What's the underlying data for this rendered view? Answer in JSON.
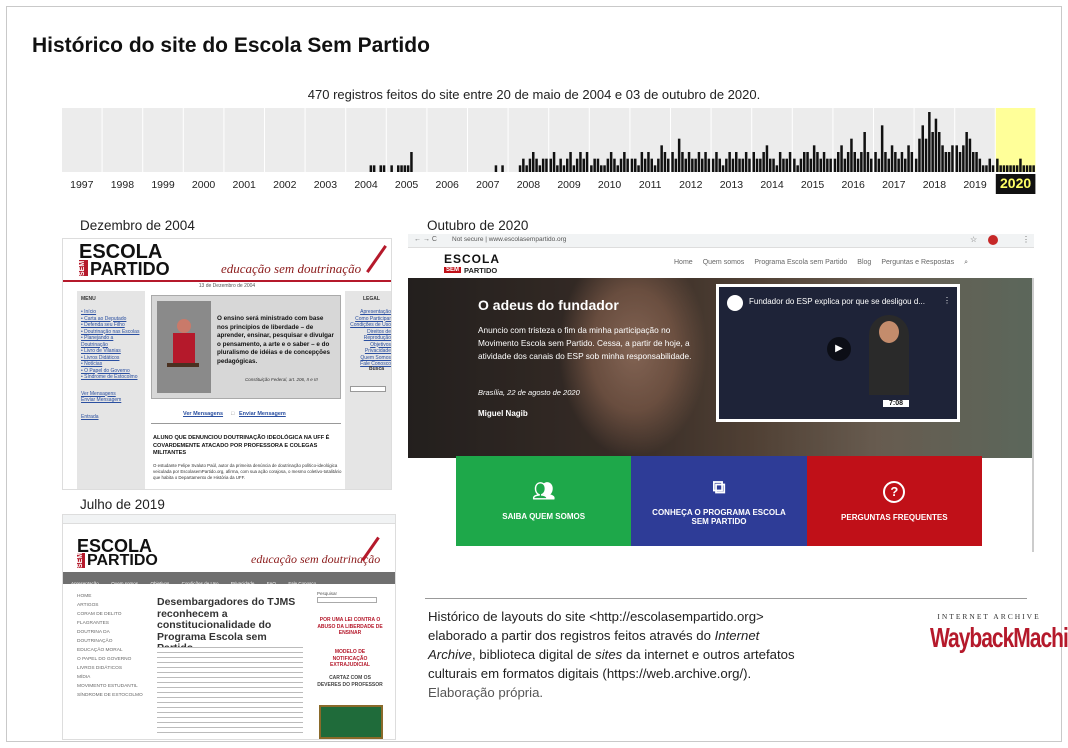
{
  "title": "Histórico do site do Escola Sem Partido",
  "subtitle": "470 registros feitos do site entre 20 de maio de 2004 e  03 de outubro de 2020.",
  "timeline": {
    "years": [
      "1997",
      "1998",
      "1999",
      "2000",
      "2001",
      "2002",
      "2003",
      "2004",
      "2005",
      "2006",
      "2007",
      "2008",
      "2009",
      "2010",
      "2011",
      "2012",
      "2013",
      "2014",
      "2015",
      "2016",
      "2017",
      "2018",
      "2019",
      "2020"
    ],
    "highlight_year": "2020",
    "highlight_color": "#ffff99",
    "bar_color": "#111111",
    "captures_per_month": {
      "2004": [
        0,
        0,
        0,
        0,
        0,
        0,
        0,
        1,
        1,
        0,
        1,
        1
      ],
      "2005": [
        0,
        1,
        0,
        1,
        1,
        1,
        1,
        3,
        0,
        0,
        0,
        0
      ],
      "2007": [
        0,
        0,
        0,
        0,
        0,
        0,
        0,
        0,
        1,
        0,
        1,
        0
      ],
      "2008": [
        0,
        0,
        0,
        1,
        2,
        1,
        2,
        3,
        2,
        1,
        2,
        2
      ],
      "2009": [
        2,
        3,
        1,
        2,
        1,
        2,
        3,
        1,
        2,
        3,
        2,
        3
      ],
      "2010": [
        1,
        2,
        2,
        1,
        1,
        2,
        3,
        2,
        1,
        2,
        3,
        2
      ],
      "2011": [
        2,
        2,
        1,
        3,
        2,
        3,
        2,
        1,
        2,
        4,
        3,
        2
      ],
      "2012": [
        3,
        2,
        5,
        3,
        2,
        3,
        2,
        2,
        3,
        2,
        3,
        2
      ],
      "2013": [
        2,
        3,
        2,
        1,
        2,
        3,
        2,
        3,
        2,
        2,
        3,
        2
      ],
      "2014": [
        3,
        2,
        2,
        3,
        4,
        2,
        2,
        1,
        3,
        2,
        2,
        3
      ],
      "2015": [
        2,
        1,
        2,
        3,
        3,
        2,
        4,
        3,
        2,
        3,
        2,
        2
      ],
      "2016": [
        2,
        3,
        4,
        2,
        3,
        5,
        3,
        2,
        3,
        6,
        3,
        2
      ],
      "2017": [
        3,
        2,
        7,
        3,
        2,
        4,
        3,
        2,
        3,
        2,
        4,
        3
      ],
      "2018": [
        2,
        5,
        7,
        5,
        9,
        6,
        8,
        6,
        4,
        3,
        3,
        4
      ],
      "2019": [
        4,
        3,
        4,
        6,
        5,
        3,
        3,
        2,
        1,
        1,
        2,
        1
      ],
      "2020": [
        2,
        1,
        1,
        1,
        1,
        1,
        1,
        2,
        1,
        1,
        1,
        1
      ]
    }
  },
  "captions": {
    "dec2004": "Dezembro de 2004",
    "oct2020": "Outubro de 2020",
    "jul2019": "Julho de 2019"
  },
  "dec2004": {
    "logo_escola": "ESCOLA",
    "logo_sem": "SEM",
    "logo_partido": "PARTIDO",
    "tagline": "educação sem doutrinação",
    "date": "13 de Dezembro de 2004",
    "menu_title": "MENU",
    "legal_title": "LEGAL",
    "busca": "Busca",
    "quote": "O ensino será ministrado com base nos princípios de liberdade – de aprender, ensinar, pesquisar e divulgar o pensamento, a arte e o saber – e do pluralismo de idéias e de concepções pedagógicas.",
    "quote_source": "Constituição Federal, art. 206, II e III",
    "ver_mensagens": "Ver Mensagens",
    "enviar_mensagem": "Enviar Mensagem",
    "headline": "ALUNO QUE DENUNCIOU DOUTRINAÇÃO IDEOLÓGICA NA UFF É COVARDEMENTE ATACADO POR PROFESSORA E COLEGAS MILITANTES",
    "body": "O estudante Felipe Svaluto Paúl, autor da primeira denúncia de doutrinação político-ideológica veiculada por EscolasemPartido.org, afirma, com sua ação corajosa, o mesmo coletivo-totalitário que habita o Departamento de História da UFF."
  },
  "oct2020": {
    "url": "Not secure  |  www.escolasempartido.org",
    "logo_escola": "ESCOLA",
    "logo_sem": "SEM",
    "logo_partido": "PARTIDO",
    "nav": [
      "Home",
      "Quem somos",
      "Programa Escola sem Partido",
      "Blog",
      "Perguntas e Respostas"
    ],
    "hero_title": "O adeus do fundador",
    "hero_text": "Anuncio com tristeza o fim da minha participação no Movimento Escola sem Partido. Cessa, a partir de hoje, a atividade dos canais do ESP sob minha responsabilidade.",
    "hero_date": "Brasília, 22 de agosto de 2020",
    "hero_author": "Miguel Nagib",
    "video_title": "Fundador do ESP explica por que se desligou d...",
    "video_time": "7:08",
    "panels": [
      {
        "label": "SAIBA QUEM SOMOS",
        "icon": "people-icon",
        "color": "#1ea84a"
      },
      {
        "label": "CONHEÇA O PROGRAMA ESCOLA SEM PARTIDO",
        "icon": "external-link-icon",
        "color": "#2e3c97"
      },
      {
        "label": "PERGUNTAS FREQUENTES",
        "icon": "question-icon",
        "color": "#c01018"
      }
    ]
  },
  "jul2019": {
    "logo_escola": "ESCOLA",
    "logo_sem": "SEM",
    "logo_partido": "PARTIDO",
    "tagline": "educação sem doutrinação",
    "nav": [
      "Apresentação",
      "Quem somos",
      "Objetivos",
      "Condições de Uso",
      "Privacidade",
      "FAQ",
      "Fale Conosco"
    ],
    "sidebar": [
      "HOME",
      "ARTIGOS",
      "CORAM DE DELITO",
      "FLAGRANTES",
      "DOUTRINA DA DOUTRINAÇÃO",
      "EDUCAÇÃO MORAL",
      "O PAPEL DO GOVERNO",
      "LIVROS DIDÁTICOS",
      "MÍDIA",
      "MOVIMENTO ESTUDANTIL",
      "SÍNDROME DE ESTOCOLMO"
    ],
    "headline": "Desembargadores do TJMS reconhecem a constitucionalidade do Programa Escola sem Partido",
    "right_boxes": [
      "POR UMA LEI CONTRA O ABUSO DA LIBERDADE DE ENSINAR",
      "MODELO DE NOTIFICAÇÃO EXTRAJUDICIAL",
      "CARTAZ COM OS DEVERES DO PROFESSOR"
    ],
    "search_label": "Pesquisar"
  },
  "description": {
    "line1": "Histórico de layouts do site <http://escolasempartido.org>",
    "line2a": "elaborado a partir dos registros feitos através do ",
    "line2b": "Internet Archive",
    "line3a": ",  biblioteca digital de ",
    "line3b": "sites",
    "line3c": " da internet e outros artefatos culturais em formatos digitais (https://web.archive.org/).",
    "own": " Elaboração própria."
  },
  "wayback": {
    "top": "INTERNET ARCHIVE",
    "main": "WaybackMachine"
  }
}
